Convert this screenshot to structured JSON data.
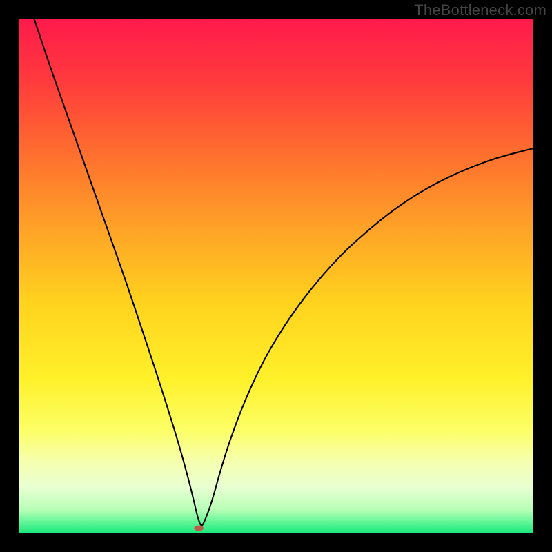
{
  "watermark": "TheBottleneck.com",
  "chart_data": {
    "type": "line",
    "title": "",
    "xlabel": "",
    "ylabel": "",
    "xlim": [
      0,
      100
    ],
    "ylim": [
      0,
      100
    ],
    "background_gradient": {
      "stops": [
        {
          "offset": 0.0,
          "color": "#ff1a4b"
        },
        {
          "offset": 0.12,
          "color": "#ff3a3d"
        },
        {
          "offset": 0.25,
          "color": "#ff6a2f"
        },
        {
          "offset": 0.4,
          "color": "#ffa028"
        },
        {
          "offset": 0.55,
          "color": "#ffd21e"
        },
        {
          "offset": 0.7,
          "color": "#fff12a"
        },
        {
          "offset": 0.8,
          "color": "#fcff66"
        },
        {
          "offset": 0.86,
          "color": "#f6ffae"
        },
        {
          "offset": 0.91,
          "color": "#e9ffd2"
        },
        {
          "offset": 0.955,
          "color": "#b6ffb6"
        },
        {
          "offset": 0.975,
          "color": "#6cf79a"
        },
        {
          "offset": 1.0,
          "color": "#17e87c"
        }
      ]
    },
    "series": [
      {
        "name": "bottleneck-curve",
        "color": "#000000",
        "width": 2.1,
        "x": [
          3.0,
          6.0,
          9.0,
          12.0,
          15.0,
          18.0,
          21.0,
          24.0,
          27.0,
          30.0,
          31.5,
          33.0,
          34.0,
          34.8,
          35.5,
          36.2,
          37.5,
          39.0,
          41.0,
          44.0,
          48.0,
          53.0,
          58.0,
          63.0,
          68.0,
          73.0,
          78.0,
          83.0,
          88.0,
          93.0,
          98.0,
          100.0
        ],
        "y": [
          100.0,
          91.0,
          82.5,
          74.0,
          65.5,
          57.0,
          48.5,
          39.5,
          30.5,
          21.0,
          16.0,
          10.5,
          6.5,
          3.0,
          1.2,
          2.5,
          6.0,
          11.5,
          18.0,
          26.0,
          34.5,
          42.5,
          49.0,
          54.5,
          59.0,
          63.0,
          66.3,
          69.0,
          71.2,
          73.0,
          74.3,
          74.8
        ]
      }
    ],
    "marker": {
      "name": "optimum-point",
      "x": 35.0,
      "y": 1.0,
      "rx": 0.9,
      "ry": 0.55,
      "color": "#c05a4a"
    }
  }
}
